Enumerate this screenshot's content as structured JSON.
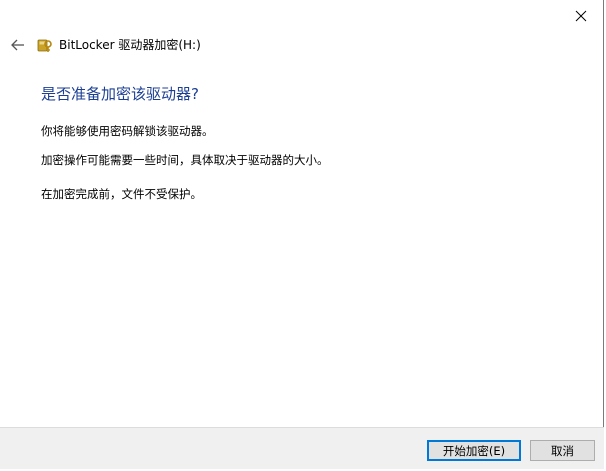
{
  "window": {
    "title": "BitLocker 驱动器加密(H:)"
  },
  "icons": {
    "close": "close-icon",
    "back": "arrow-left-icon",
    "app": "bitlocker-key-icon"
  },
  "content": {
    "heading": "是否准备加密该驱动器?",
    "paragraphs": [
      "你将能够使用密码解锁该驱动器。",
      "加密操作可能需要一些时间，具体取决于驱动器的大小。",
      "在加密完成前，文件不受保护。"
    ]
  },
  "footer": {
    "start_label": "开始加密(E)",
    "cancel_label": "取消"
  },
  "colors": {
    "heading": "#1c3f94",
    "footer_bg": "#f0f0f0",
    "default_button_border": "#0078d7"
  }
}
